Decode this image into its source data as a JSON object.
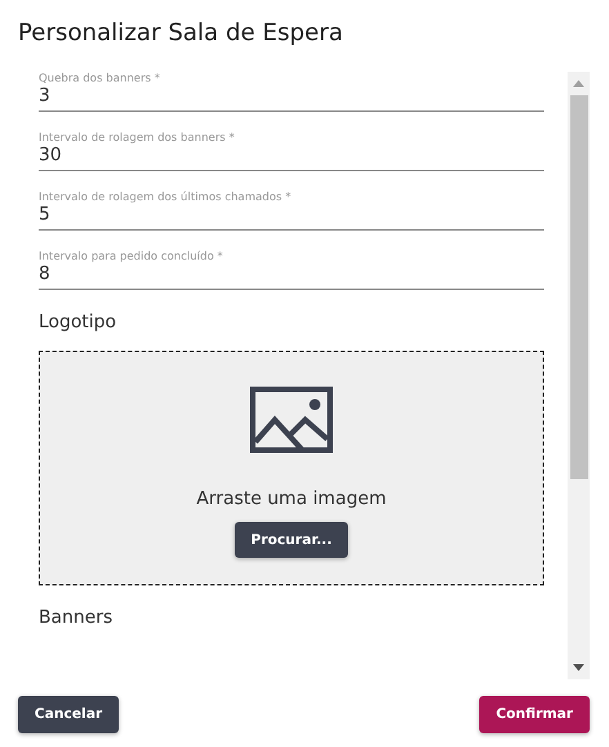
{
  "dialog": {
    "title": "Personalizar Sala de Espera"
  },
  "fields": [
    {
      "label": "Quebra dos banners *",
      "value": "3"
    },
    {
      "label": "Intervalo de rolagem dos banners *",
      "value": "30"
    },
    {
      "label": "Intervalo de rolagem dos últimos chamados *",
      "value": "5"
    },
    {
      "label": "Intervalo para pedido concluído *",
      "value": "8"
    }
  ],
  "logo_section": {
    "heading": "Logotipo",
    "dropzone_text": "Arraste uma imagem",
    "browse_button": "Procurar..."
  },
  "banners_section": {
    "heading": "Banners"
  },
  "buttons": {
    "cancel": "Cancelar",
    "confirm": "Confirmar"
  }
}
